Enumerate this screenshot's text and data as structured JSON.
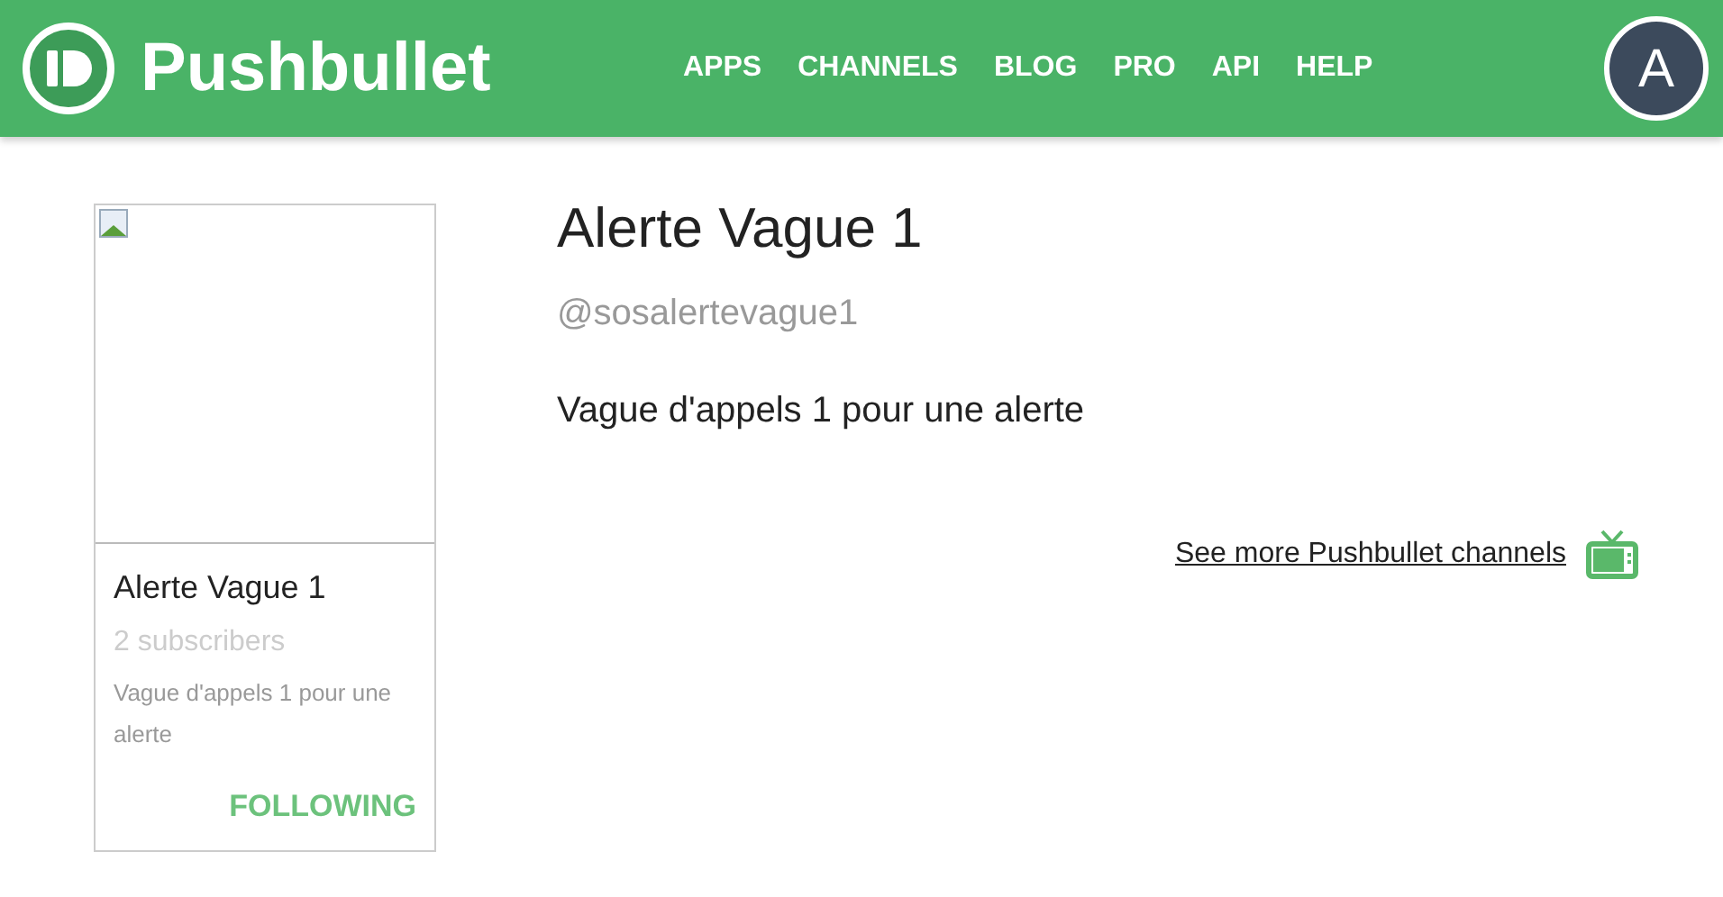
{
  "header": {
    "logo": "Pushbullet",
    "nav": [
      "APPS",
      "CHANNELS",
      "BLOG",
      "PRO",
      "API",
      "HELP"
    ],
    "avatar": "A"
  },
  "card": {
    "title": "Alerte Vague 1",
    "subscribers": "2 subscribers",
    "description": "Vague d'appels 1 pour une alerte",
    "following": true,
    "button": "FOLLOWING"
  },
  "channel": {
    "title": "Alerte Vague 1",
    "handle": "@sosalertevague1",
    "description": "Vague d'appels 1 pour une alerte"
  },
  "more_link": "See more Pushbullet channels"
}
